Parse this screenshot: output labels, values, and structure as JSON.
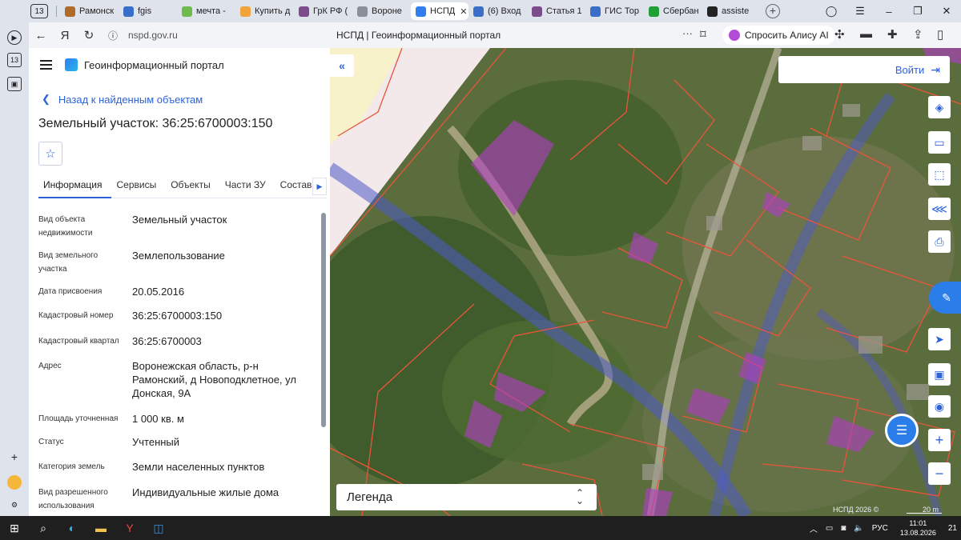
{
  "browser": {
    "tab_count": "13",
    "tabs": [
      {
        "label": "Рамонск",
        "color": "#b06a2a"
      },
      {
        "label": "fgis",
        "color": "#3a6fc9"
      },
      {
        "label": "мечта -",
        "color": "#6dbb4d"
      },
      {
        "label": "Купить д",
        "color": "#f2a43c"
      },
      {
        "label": "ГрК РФ (",
        "color": "#7b4b8a"
      },
      {
        "label": "Вороне",
        "color": "#8a8f99"
      },
      {
        "label": "НСПД",
        "color": "#2f7ff0"
      },
      {
        "label": "(6) Вход",
        "color": "#3a6fc9"
      },
      {
        "label": "Статья 1",
        "color": "#7b4b8a"
      },
      {
        "label": "ГИС Тор",
        "color": "#3a6fc9"
      },
      {
        "label": "Сбербан",
        "color": "#21a038"
      },
      {
        "label": "assiste",
        "color": "#222222"
      }
    ],
    "url": "nspd.gov.ru",
    "page_title": "НСПД | Геоинформационный портал",
    "alice_label": "Спросить Алису AI"
  },
  "panel": {
    "portal_name": "Геоинформационный портал",
    "back_label": "Назад к найденным объектам",
    "object_title": "Земельный участок: 36:25:6700003:150",
    "tabs": [
      "Информация",
      "Сервисы",
      "Объекты",
      "Части ЗУ",
      "Состав"
    ],
    "properties": [
      {
        "key": "Вид объекта недвижимости",
        "value": "Земельный участок"
      },
      {
        "key": "Вид земельного участка",
        "value": "Землепользование"
      },
      {
        "key": "Дата присвоения",
        "value": "20.05.2016"
      },
      {
        "key": "Кадастровый номер",
        "value": "36:25:6700003:150"
      },
      {
        "key": "Кадастровый квартал",
        "value": "36:25:6700003"
      },
      {
        "key": "Адрес",
        "value": "Воронежская область, р-н Рамонский, д Новоподклетное, ул Донская, 9А"
      },
      {
        "key": "Площадь уточненная",
        "value": "1 000 кв. м"
      },
      {
        "key": "Статус",
        "value": "Учтенный"
      },
      {
        "key": "Категория земель",
        "value": "Земли населенных пунктов"
      },
      {
        "key": "Вид разрешенного использования",
        "value": "Индивидуальные жилые дома"
      }
    ]
  },
  "map": {
    "login_label": "Войти",
    "legend_label": "Легенда",
    "credit": "НСПД 2026 ©",
    "scale_label": "20 m",
    "colors": {
      "parcel_line": "#e8553b",
      "highlight": "#b23cc8",
      "road": "#4d59c9"
    }
  },
  "taskbar": {
    "lang": "РУС",
    "time": "11:01",
    "date": "13.08.2026",
    "notif": "21"
  }
}
